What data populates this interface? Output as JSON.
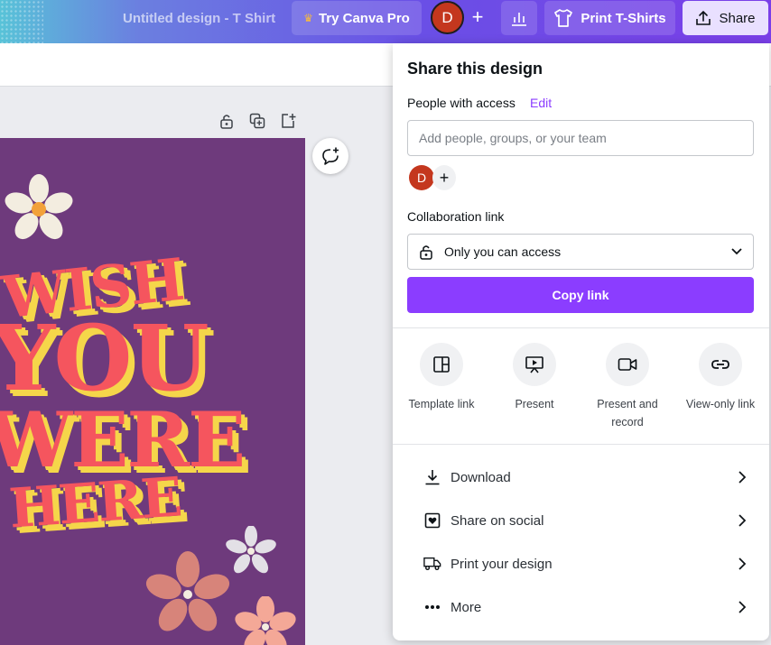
{
  "topbar": {
    "doc_title": "Untitled design - T Shirt",
    "try_pro_label": "Try Canva Pro",
    "avatar_initial": "D",
    "print_label": "Print T-Shirts",
    "share_label": "Share",
    "icons": [
      "crown-icon",
      "plus-icon",
      "analytics-icon",
      "tshirt-icon",
      "share-upload-icon"
    ]
  },
  "page_tools": {
    "icons": [
      "lock-icon",
      "duplicate-page-icon",
      "add-page-icon"
    ]
  },
  "design": {
    "text_lines": [
      "WISH",
      "YOU",
      "WERE",
      "HERE"
    ],
    "colors": {
      "background": "#6e3a7c",
      "text": "#f5555e",
      "shadow": "#f5d64a"
    }
  },
  "share_panel": {
    "title": "Share this design",
    "people_label": "People with access",
    "edit_label": "Edit",
    "input_placeholder": "Add people, groups, or your team",
    "avatar_initial": "D",
    "collab_label": "Collaboration link",
    "access_value": "Only you can access",
    "copy_label": "Copy link",
    "options": [
      {
        "label": "Template link",
        "icon": "template-icon"
      },
      {
        "label": "Present",
        "icon": "present-icon"
      },
      {
        "label": "Present and record",
        "icon": "video-camera-icon"
      },
      {
        "label": "View-only link",
        "icon": "link-icon"
      }
    ],
    "list": [
      {
        "label": "Download",
        "icon": "download-icon"
      },
      {
        "label": "Share on social",
        "icon": "heart-icon"
      },
      {
        "label": "Print your design",
        "icon": "truck-icon"
      },
      {
        "label": "More",
        "icon": "more-icon"
      }
    ]
  },
  "accent_color": "#8b3dff"
}
